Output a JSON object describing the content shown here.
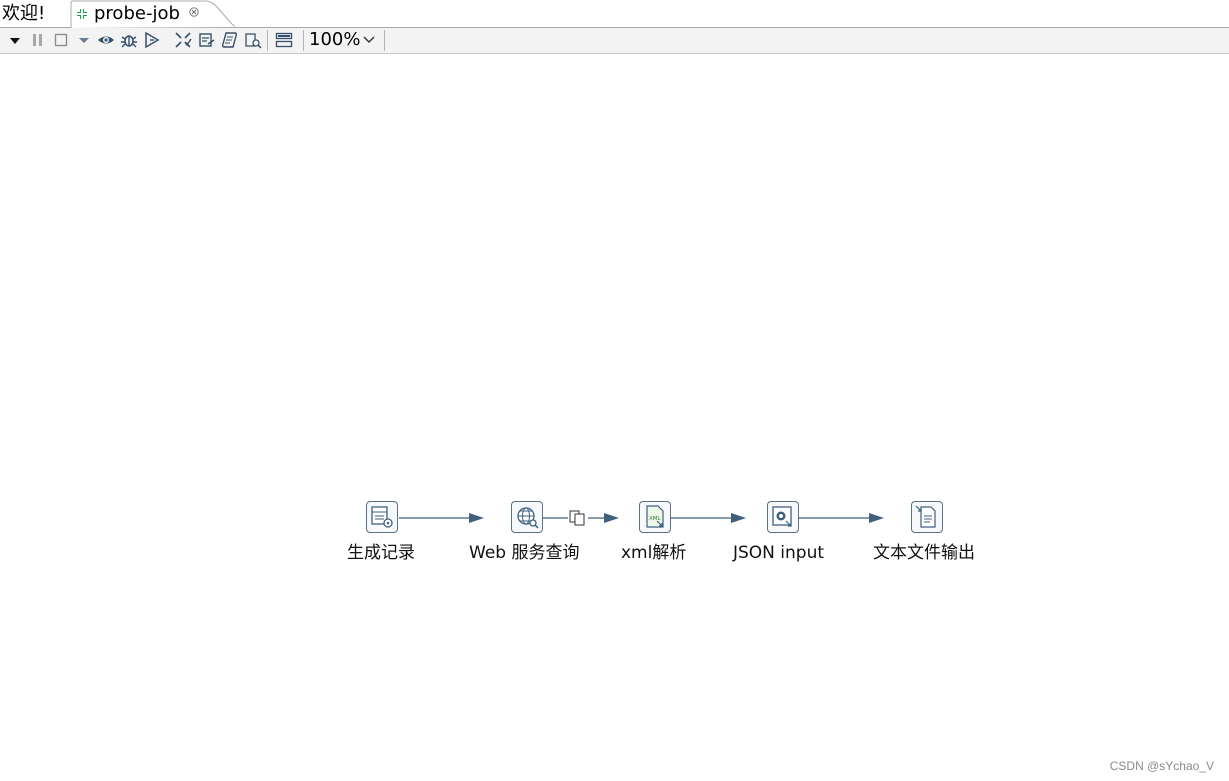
{
  "tabs": {
    "welcome_label": "欢迎!",
    "active_label": "probe-job",
    "active_icon": "transformation-icon",
    "close_icon": "close-icon"
  },
  "toolbar": {
    "buttons": [
      "run-dropdown-icon",
      "pause-icon",
      "stop-icon",
      "stop-dropdown-icon",
      "preview-icon",
      "debug-icon",
      "replay-icon",
      "verify-icon",
      "impact-icon",
      "sql-icon",
      "explore-db-icon",
      "show-results-icon"
    ],
    "zoom_value": "100%"
  },
  "steps": [
    {
      "label": "生成记录",
      "icon": "generate-rows-icon"
    },
    {
      "label": "Web 服务查询",
      "icon": "web-service-icon"
    },
    {
      "label": "xml解析",
      "icon": "xml-input-icon"
    },
    {
      "label": "JSON input",
      "icon": "json-input-icon"
    },
    {
      "label": "文本文件输出",
      "icon": "text-output-icon"
    }
  ],
  "hops": [
    {
      "from": "生成记录",
      "to": "Web 服务查询"
    },
    {
      "from": "Web 服务查询",
      "to": "xml解析",
      "marker": "copy-rows-icon"
    },
    {
      "from": "xml解析",
      "to": "JSON input"
    },
    {
      "from": "JSON input",
      "to": "文本文件输出"
    }
  ],
  "colors": {
    "hop": "#3f5f7f",
    "active_tab_icon": "#1aa34a"
  },
  "watermark": "CSDN @sYchao_V"
}
